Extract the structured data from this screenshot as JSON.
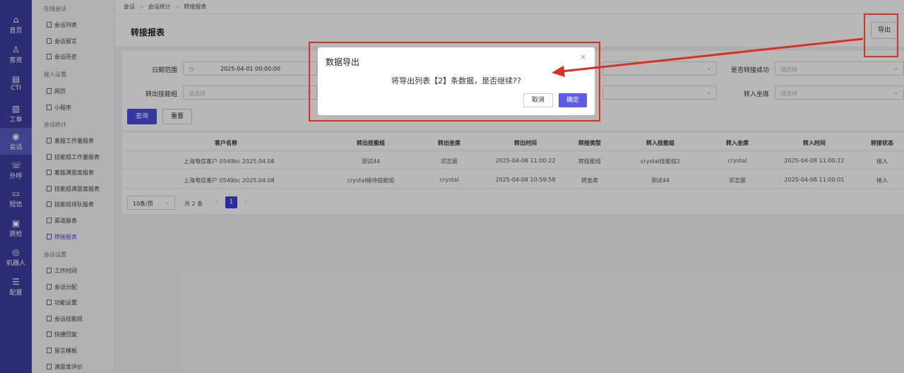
{
  "rail": [
    {
      "label": "首页",
      "icon": "home-icon",
      "glyph": "⌂"
    },
    {
      "label": "客资",
      "icon": "user-icon",
      "glyph": "♙"
    },
    {
      "label": "CTI",
      "icon": "cti-icon",
      "glyph": "▤"
    },
    {
      "label": "工单",
      "icon": "ticket-icon",
      "glyph": "▥"
    },
    {
      "label": "会话",
      "icon": "chat-icon",
      "glyph": "◉"
    },
    {
      "label": "外呼",
      "icon": "phone-icon",
      "glyph": "☏"
    },
    {
      "label": "短信",
      "icon": "sms-icon",
      "glyph": "▭"
    },
    {
      "label": "质检",
      "icon": "inspect-icon",
      "glyph": "▣"
    },
    {
      "label": "机器人",
      "icon": "robot-icon",
      "glyph": "◎"
    },
    {
      "label": "配置",
      "icon": "settings-icon",
      "glyph": "☰"
    }
  ],
  "submenu": {
    "g1": "在线会话",
    "g2": "接入设置",
    "g3": "会话统计",
    "g4": "会话设置",
    "items1": [
      "会话列表",
      "会话留言",
      "会话历史"
    ],
    "items2": [
      "网页",
      "小程序"
    ],
    "items3": [
      "客服工作量报表",
      "技能组工作量报表",
      "客服满意度报表",
      "技能组满意度报表",
      "技能组排队报表",
      "渠道报表",
      "转接报表"
    ],
    "items4": [
      "工作时间",
      "会话分配",
      "功能设置",
      "会话技能组",
      "快捷回复",
      "留言模板",
      "满意度评价"
    ]
  },
  "breadcrumb": [
    "会话",
    "会话统计",
    "转接报表"
  ],
  "page_title": "转接报表",
  "export_label": "导出",
  "filters": {
    "date_label": "日期范围",
    "date_value": "2025-04-01 00:00:00",
    "out_group_label": "转出技能组",
    "placeholder": "请选择",
    "success_label": "是否转接成功",
    "in_seat_label": "转入坐席",
    "query": "查询",
    "reset": "重置"
  },
  "table": {
    "columns": [
      "客户名称",
      "转出技能组",
      "转出坐席",
      "转出时间",
      "转接类型",
      "转入技能组",
      "转入坐席",
      "转入时间",
      "转接状态"
    ],
    "rows": [
      [
        "上海电信客户 0549bc 2025.04.08",
        "测试44",
        "邓志丽",
        "2025-04-08 11:00:22",
        "转技能组",
        "crystal技能组2",
        "crystal",
        "2025-04-08 11:00:22",
        "接入"
      ],
      [
        "上海电信客户 0549bc 2025.04.08",
        "crystal接待技能组",
        "crystal",
        "2025-04-08 10:59:58",
        "转坐席",
        "测试44",
        "邓志丽",
        "2025-04-08 11:00:01",
        "接入"
      ]
    ]
  },
  "pager": {
    "size": "10条/页",
    "total": "共 2 条",
    "page": "1"
  },
  "modal": {
    "title": "数据导出",
    "message": "将导出列表【2】条数据，是否继续??",
    "cancel": "取消",
    "ok": "确定",
    "close": "×"
  },
  "colors": {
    "accent": "#4b4de3",
    "annotation": "#d93025"
  }
}
